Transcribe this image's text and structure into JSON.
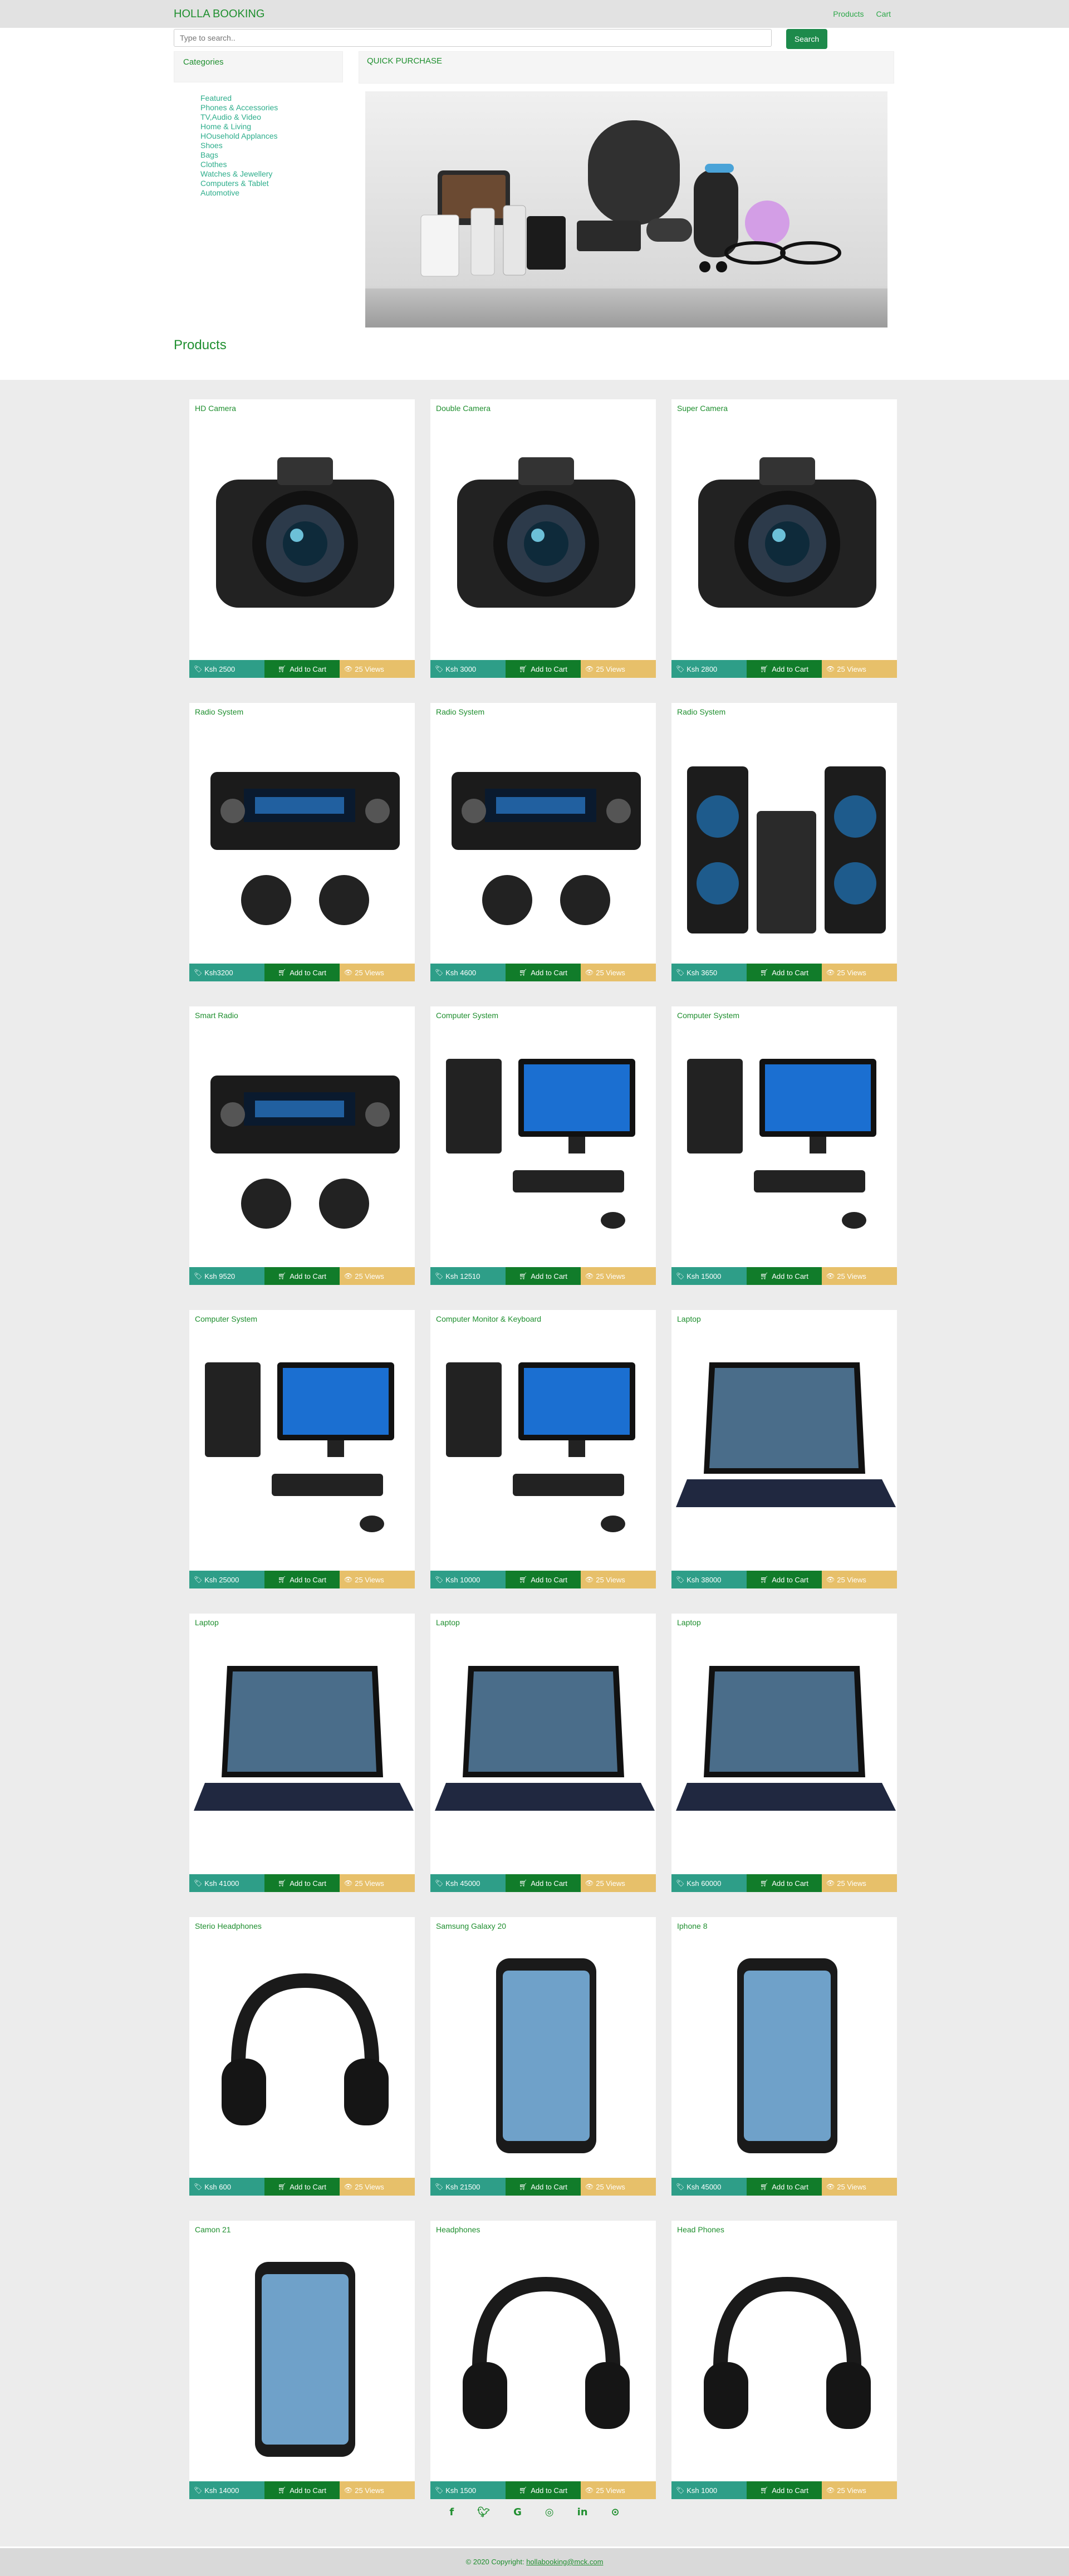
{
  "nav": {
    "brand": "HOLLA BOOKING",
    "links": [
      "Products",
      "Cart"
    ]
  },
  "search": {
    "placeholder": "Type to search..",
    "button": "Search"
  },
  "categories": {
    "title": "Categories",
    "items": [
      "Featured",
      "Phones & Accessories",
      "TV,Audio & Video",
      "Home & Living",
      "HOusehold Applances",
      "Shoes",
      "Bags",
      "Clothes",
      "Watches & Jewellery",
      "Computers & Tablet",
      "Automotive"
    ]
  },
  "quick_purchase": {
    "title": "QUICK PURCHASE"
  },
  "products_title": "Products",
  "products": [
    {
      "name": "HD Camera",
      "price": "Ksh 2500",
      "cart": "Add to Cart",
      "views": "25 Views",
      "icon": "camera-icon"
    },
    {
      "name": "Double Camera",
      "price": "Ksh 3000",
      "cart": "Add to Cart",
      "views": "25 Views",
      "icon": "camera-icon"
    },
    {
      "name": "Super Camera",
      "price": "Ksh 2800",
      "cart": "Add to Cart",
      "views": "25 Views",
      "icon": "camera-icon"
    },
    {
      "name": "Radio System",
      "price": "Ksh3200",
      "cart": "Add to Cart",
      "views": "25 Views",
      "icon": "radio-icon"
    },
    {
      "name": "Radio System",
      "price": "Ksh 4600",
      "cart": "Add to Cart",
      "views": "25 Views",
      "icon": "radio-icon"
    },
    {
      "name": "Radio System",
      "price": "Ksh 3650",
      "cart": "Add to Cart",
      "views": "25 Views",
      "icon": "speaker-icon"
    },
    {
      "name": "Smart Radio",
      "price": "Ksh 9520",
      "cart": "Add to Cart",
      "views": "25 Views",
      "icon": "radio-icon"
    },
    {
      "name": "Computer System",
      "price": "Ksh 12510",
      "cart": "Add to Cart",
      "views": "25 Views",
      "icon": "computer-icon"
    },
    {
      "name": "Computer System",
      "price": "Ksh 15000",
      "cart": "Add to Cart",
      "views": "25 Views",
      "icon": "computer-icon"
    },
    {
      "name": "Computer System",
      "price": "Ksh 25000",
      "cart": "Add to Cart",
      "views": "25 Views",
      "icon": "computer-icon"
    },
    {
      "name": "Computer Monitor & Keyboard",
      "price": "Ksh 10000",
      "cart": "Add to Cart",
      "views": "25 Views",
      "icon": "computer-icon"
    },
    {
      "name": "Laptop",
      "price": "Ksh 38000",
      "cart": "Add to Cart",
      "views": "25 Views",
      "icon": "laptop-icon"
    },
    {
      "name": "Laptop",
      "price": "Ksh 41000",
      "cart": "Add to Cart",
      "views": "25 Views",
      "icon": "laptop-icon"
    },
    {
      "name": "Laptop",
      "price": "Ksh 45000",
      "cart": "Add to Cart",
      "views": "25 Views",
      "icon": "laptop-icon"
    },
    {
      "name": "Laptop",
      "price": "Ksh 60000",
      "cart": "Add to Cart",
      "views": "25 Views",
      "icon": "laptop-icon"
    },
    {
      "name": "Sterio Headphones",
      "price": "Ksh 600",
      "cart": "Add to Cart",
      "views": "25 Views",
      "icon": "headphones-icon"
    },
    {
      "name": "Samsung Galaxy 20",
      "price": "Ksh 21500",
      "cart": "Add to Cart",
      "views": "25 Views",
      "icon": "phone-icon"
    },
    {
      "name": "Iphone 8",
      "price": "Ksh 45000",
      "cart": "Add to Cart",
      "views": "25 Views",
      "icon": "phone-icon"
    },
    {
      "name": "Camon 21",
      "price": "Ksh 14000",
      "cart": "Add to Cart",
      "views": "25 Views",
      "icon": "phone-icon"
    },
    {
      "name": "Headphones",
      "price": "Ksh 1500",
      "cart": "Add to Cart",
      "views": "25 Views",
      "icon": "headphones-icon"
    },
    {
      "name": "Head Phones",
      "price": "Ksh 1000",
      "cart": "Add to Cart",
      "views": "25 Views",
      "icon": "headphones-icon"
    }
  ],
  "social": [
    "facebook-icon",
    "twitter-icon",
    "google-icon",
    "instagram-icon",
    "linkedin-icon",
    "github-icon"
  ],
  "footer": {
    "text": "© 2020 Copyright:",
    "link": "hollabooking@mck.com"
  },
  "colors": {
    "accent": "#1f8f2f",
    "price": "#2e9e88",
    "cart": "#117c2a",
    "views": "#e7c06a"
  }
}
